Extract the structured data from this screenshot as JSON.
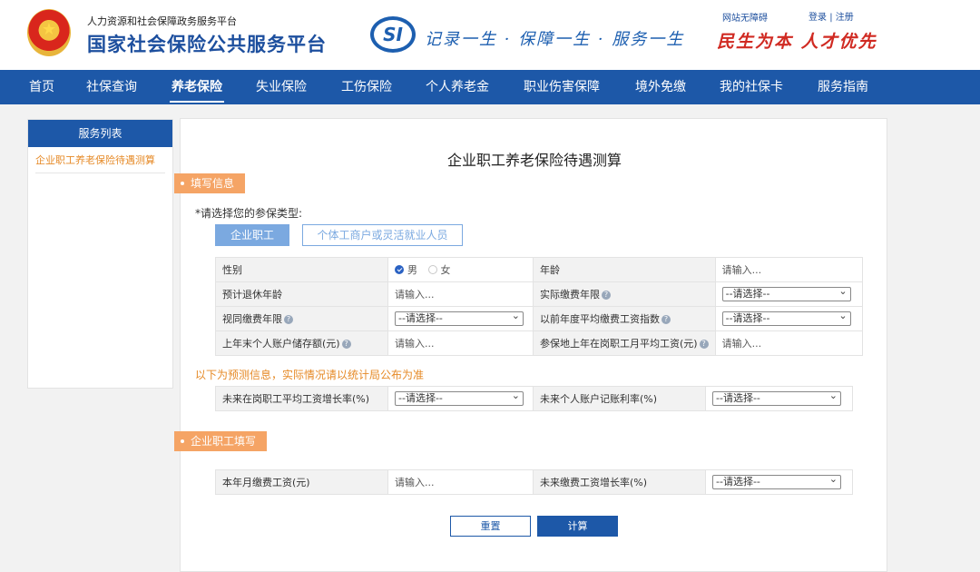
{
  "header": {
    "org_sub": "人力资源和社会保障政务服务平台",
    "org_main": "国家社会保险公共服务平台",
    "si_logo": "SI",
    "slogan": "记录一生 · 保障一生 · 服务一生",
    "accessibility": "网站无障碍",
    "login": "登录",
    "separator": "|",
    "register": "注册",
    "motto": "民生为本 人才优先"
  },
  "nav": {
    "items": [
      "首页",
      "社保查询",
      "养老保险",
      "失业保险",
      "工伤保险",
      "个人养老金",
      "职业伤害保障",
      "境外免缴",
      "我的社保卡",
      "服务指南"
    ],
    "active": "养老保险"
  },
  "sidebar": {
    "title": "服务列表",
    "items": [
      "企业职工养老保险待遇测算"
    ]
  },
  "main": {
    "title": "企业职工养老保险待遇测算",
    "section1": "填写信息",
    "prompt": "*请选择您的参保类型:",
    "type_active": "企业职工",
    "type_other": "个体工商户或灵活就业人员",
    "table1": {
      "gender_label": "性别",
      "male": "男",
      "female": "女",
      "age_label": "年龄",
      "age_placeholder": "请输入...",
      "retire_label": "预计退休年龄",
      "retire_placeholder": "请输入...",
      "actual_years_label": "实际缴费年限",
      "actual_years_value": "--请选择--",
      "deemed_years_label": "视同缴费年限",
      "deemed_years_value": "--请选择--",
      "avg_index_label": "以前年度平均缴费工资指数",
      "avg_index_value": "--请选择--",
      "balance_label": "上年末个人账户储存额(元)",
      "balance_placeholder": "请输入...",
      "avg_wage_label": "参保地上年在岗职工月平均工资(元)",
      "avg_wage_placeholder": "请输入..."
    },
    "note": "以下为预测信息，实际情况请以统计局公布为准",
    "table2": {
      "wage_growth_label": "未来在岗职工平均工资增长率(%)",
      "wage_growth_value": "--请选择--",
      "interest_label": "未来个人账户记账利率(%)",
      "interest_value": "--请选择--"
    },
    "section2": "企业职工填写",
    "table3": {
      "month_wage_label": "本年月缴费工资(元)",
      "month_wage_placeholder": "请输入...",
      "future_growth_label": "未来缴费工资增长率(%)",
      "future_growth_value": "--请选择--"
    },
    "reset": "重置",
    "calculate": "计算"
  },
  "icons": {
    "help": "?"
  },
  "colors": {
    "primary": "#1d58a8",
    "accent": "#e68a27",
    "tag": "#f5a465"
  }
}
